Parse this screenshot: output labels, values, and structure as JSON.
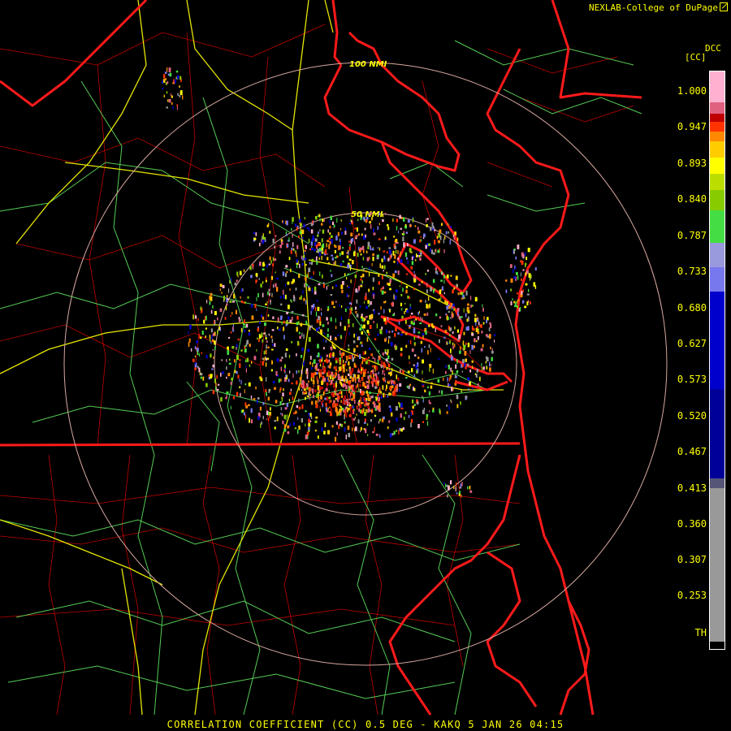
{
  "credit": "NEXLAB-College of DuPage",
  "legend": {
    "product_code": "DCC",
    "unit": "[CC]",
    "labels": [
      "1.000",
      "0.947",
      "0.893",
      "0.840",
      "0.787",
      "0.733",
      "0.680",
      "0.627",
      "0.573",
      "0.520",
      "0.467",
      "0.413",
      "0.360",
      "0.307",
      "0.253",
      "TH"
    ]
  },
  "range_rings": [
    "50 NMI",
    "100 NMI"
  ],
  "footer": "CORRELATION COEFFICIENT (CC) 0.5 DEG - KAKQ 5 JAN 26 04:15",
  "colors": {
    "background": "#000000",
    "state_border": "#ff0000",
    "county_line": "#cc0000",
    "road_major": "#ffff00",
    "road_minor": "#66dd66",
    "range_ring": "#d8a8a0",
    "text": "#ffff00"
  }
}
